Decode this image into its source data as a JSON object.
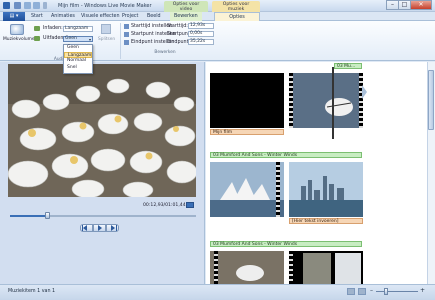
{
  "window": {
    "title": "Mijn film - Windows Live Movie Maker",
    "context_tab_video": "Opties voor video",
    "context_tab_music": "Opties voor muziek",
    "minimize": "–",
    "maximize": "□",
    "close": "✕"
  },
  "menu": {
    "file": "▤ ▾"
  },
  "tabs": [
    "Start",
    "Animaties",
    "Visuele effecten",
    "Project",
    "Beeld",
    "Bewerken",
    "Opties"
  ],
  "ribbon": {
    "music_volume_label": "Muziekvolume",
    "fade_in_label": "Infaden:",
    "fade_in_value": "Langzaam",
    "fade_out_label": "Uitfaden:",
    "fade_out_value": "Geen",
    "split_label": "Splitsen",
    "group_audio": "Audio",
    "group_edit": "Bewerken",
    "start_time_label": "Starttijd instellen",
    "start_point_label": "Startpunt instellen",
    "end_point_label": "Eindpunt instellen",
    "start_time_field_label": "Starttijd:",
    "start_time_value": "12,93s",
    "start_point_field_label": "Startpunt:",
    "start_point_value": "0,00s",
    "end_point_field_label": "Eindpunt:",
    "end_point_value": "35,22s"
  },
  "dropdown": {
    "options": [
      "Geen",
      "Langzaam",
      "Normaal",
      "Snel"
    ],
    "selected_index": 1
  },
  "preview": {
    "timecode": "00:12,93/01:01,44"
  },
  "storyboard": {
    "music_track_1": "03 Mu...",
    "caption_1": "Mijn film",
    "music_track_2": "03 Mumford And Sons - Winter Winds",
    "caption_2": "[Hier tekst invoeren]",
    "music_track_3": "03 Mumford And Sons - Winter Winds"
  },
  "status": {
    "item_count": "Muziekitem 1 van 1",
    "zoom_minus": "–",
    "zoom_plus": "+"
  }
}
